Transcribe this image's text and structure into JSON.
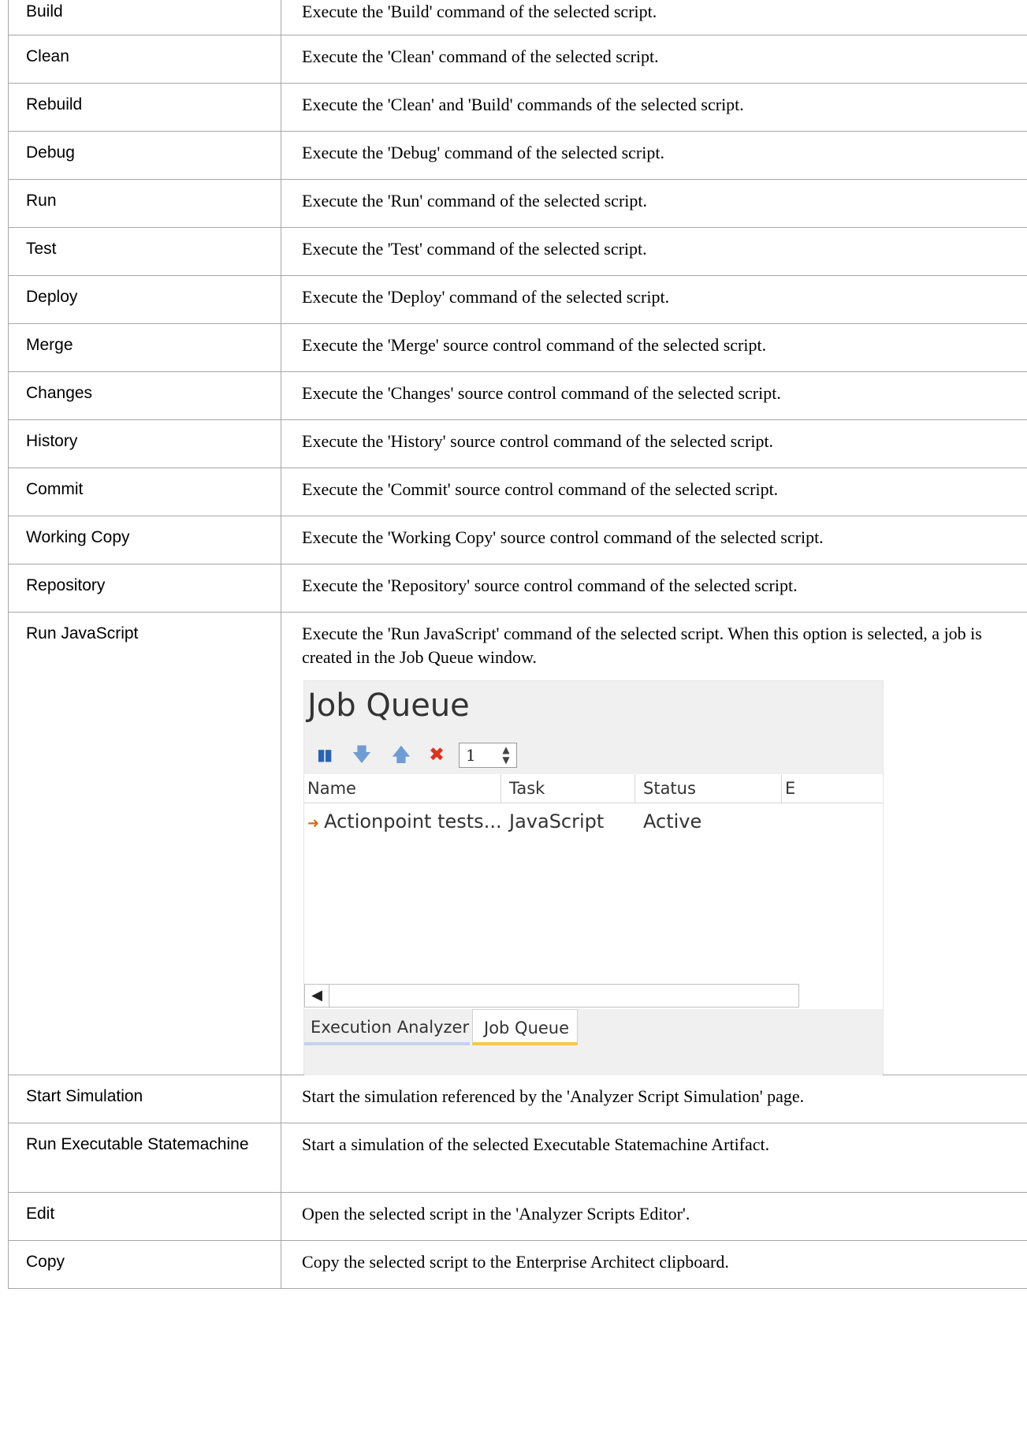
{
  "rows": [
    {
      "command": "Build",
      "description": "Execute the 'Build' command of the selected script."
    },
    {
      "command": "Clean",
      "description": "Execute the 'Clean' command of the selected script."
    },
    {
      "command": "Rebuild",
      "description": "Execute the 'Clean' and 'Build' commands of the selected script."
    },
    {
      "command": "Debug",
      "description": "Execute the 'Debug' command of the selected script."
    },
    {
      "command": "Run",
      "description": "Execute the 'Run' command of the selected script."
    },
    {
      "command": "Test",
      "description": "Execute the 'Test' command of the selected script."
    },
    {
      "command": "Deploy",
      "description": "Execute the 'Deploy' command of the selected script."
    },
    {
      "command": "Merge",
      "description": "Execute the 'Merge' source control command of the selected script."
    },
    {
      "command": "Changes",
      "description": "Execute the 'Changes' source control command of the selected script."
    },
    {
      "command": "History",
      "description": "Execute the 'History' source control command of the selected script."
    },
    {
      "command": "Commit",
      "description": "Execute the 'Commit' source control command of the selected script."
    },
    {
      "command": "Working Copy",
      "description": "Execute the 'Working Copy' source control command of the selected script."
    },
    {
      "command": "Repository",
      "description": "Execute the 'Repository' source control command of the selected script."
    },
    {
      "command": "Run JavaScript",
      "description": "Execute the 'Run JavaScript' command of the selected script. When this option is selected, a job is created in the Job Queue window."
    },
    {
      "command": "Start Simulation",
      "description": "Start the simulation referenced by the 'Analyzer Script Simulation' page."
    },
    {
      "command": "Run Executable Statemachine",
      "description": "Start a simulation of the selected Executable Statemachine Artifact."
    },
    {
      "command": "Edit",
      "description": "Open the selected script in the 'Analyzer Scripts Editor'."
    },
    {
      "command": "Copy",
      "description": "Copy the selected script to the Enterprise Architect clipboard."
    }
  ],
  "job_queue": {
    "title": "Job Queue",
    "icons": {
      "pause": "pause-icon",
      "down": "move-down-arrow-icon",
      "up": "move-up-arrow-icon",
      "delete": "delete-x-icon",
      "row": "orange-right-arrow-icon"
    },
    "spinner_value": "1",
    "columns": {
      "name": "Name",
      "task": "Task",
      "status": "Status",
      "extra": "E"
    },
    "job": {
      "name": "Actionpoint tests...",
      "task": "JavaScript",
      "status": "Active"
    },
    "tabs": {
      "execution_analyzer": "Execution Analyzer",
      "job_queue": "Job Queue"
    },
    "colors": {
      "delete_icon": "#e0301e",
      "arrow_icon": "#6f9cd4",
      "row_arrow": "#d46a1e",
      "active_tab_underline": "#f2c94c",
      "inactive_tab_underline": "#c4d3ea"
    }
  }
}
